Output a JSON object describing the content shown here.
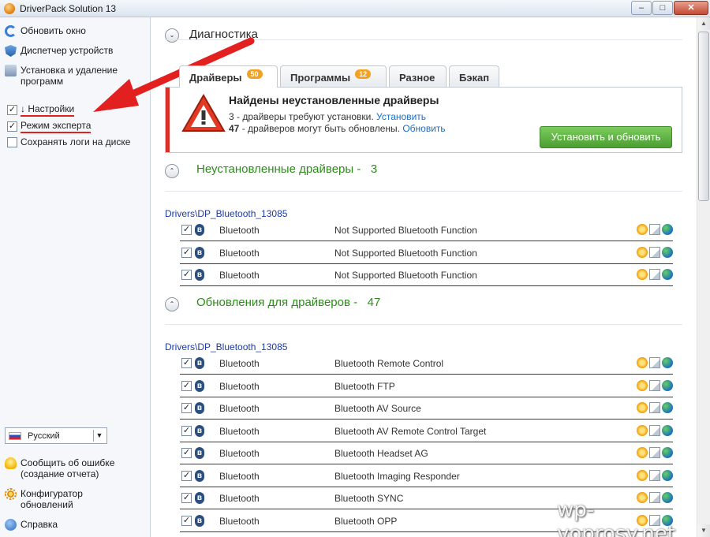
{
  "window": {
    "title": "DriverPack Solution 13",
    "minimize": "–",
    "maximize": "□",
    "close": "✕"
  },
  "sidebar": {
    "links": [
      {
        "label": "Обновить окно",
        "icon": "refresh-icon"
      },
      {
        "label": "Диспетчер устройств",
        "icon": "device-manager-icon"
      },
      {
        "label": "Установка и удаление программ",
        "icon": "programs-icon"
      }
    ],
    "options": [
      {
        "label": "↓ Настройки",
        "checked": true
      },
      {
        "label": "Режим эксперта",
        "checked": true
      },
      {
        "label": "Сохранять логи на диске",
        "checked": false
      }
    ],
    "language": {
      "value": "Русский"
    },
    "bottom_links": [
      {
        "label": "Сообщить об ошибке (создание отчета)",
        "icon": "bulb-icon"
      },
      {
        "label": "Конфигуратор обновлений",
        "icon": "gear-icon"
      },
      {
        "label": "Справка",
        "icon": "help-icon"
      }
    ]
  },
  "main": {
    "diagnostics_title": "Диагностика",
    "tabs": [
      {
        "label": "Драйверы",
        "badge": "50",
        "active": true
      },
      {
        "label": "Программы",
        "badge": "12",
        "active": false
      },
      {
        "label": "Разное",
        "badge": "",
        "active": false
      },
      {
        "label": "Бэкап",
        "badge": "",
        "active": false
      }
    ],
    "alert": {
      "title": "Найдены неустановленные драйверы",
      "line1_count": "3",
      "line1_text": " - драйверы требуют установки. ",
      "line1_link": "Установить",
      "line2_count": "47",
      "line2_text": " - драйверов могут быть обновлены. ",
      "line2_link": "Обновить",
      "button": "Установить и обновить",
      "accent_color": "#d9302a",
      "button_color": "#5cae3e"
    },
    "sections": [
      {
        "title": "Неустановленные драйверы -",
        "count": "3",
        "group_path": "Drivers\\DP_Bluetooth_13085",
        "rows": [
          {
            "category": "Bluetooth",
            "name": "Not Supported Bluetooth Function"
          },
          {
            "category": "Bluetooth",
            "name": "Not Supported Bluetooth Function"
          },
          {
            "category": "Bluetooth",
            "name": "Not Supported Bluetooth Function"
          }
        ]
      },
      {
        "title": "Обновления для драйверов -",
        "count": "47",
        "group_path": "Drivers\\DP_Bluetooth_13085",
        "rows": [
          {
            "category": "Bluetooth",
            "name": "Bluetooth Remote Control"
          },
          {
            "category": "Bluetooth",
            "name": "Bluetooth FTP"
          },
          {
            "category": "Bluetooth",
            "name": "Bluetooth AV Source"
          },
          {
            "category": "Bluetooth",
            "name": "Bluetooth AV Remote Control Target"
          },
          {
            "category": "Bluetooth",
            "name": "Bluetooth Headset AG"
          },
          {
            "category": "Bluetooth",
            "name": "Bluetooth Imaging Responder"
          },
          {
            "category": "Bluetooth",
            "name": "Bluetooth SYNC"
          },
          {
            "category": "Bluetooth",
            "name": "Bluetooth OPP"
          }
        ]
      }
    ]
  },
  "checkbox_mark": "✓",
  "collapse_glyph": "⌄",
  "expand_glyph": "⌃",
  "bluetooth_glyph": "ʙ",
  "watermark": "wp-voprosy.net",
  "annotation_color": "#e32020"
}
